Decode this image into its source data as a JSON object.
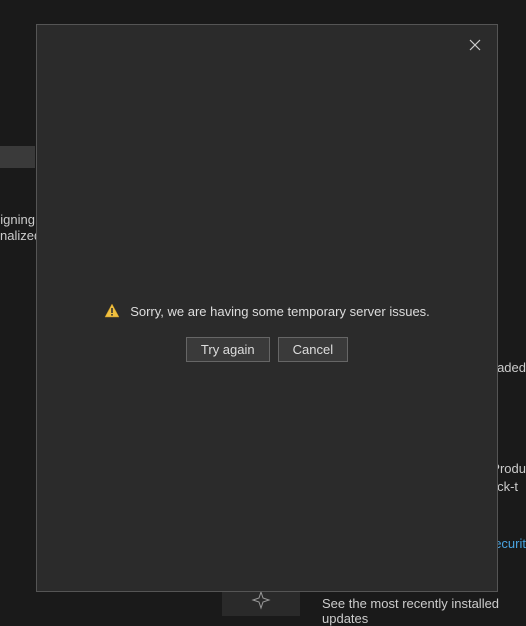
{
  "background": {
    "signing_text_line1": "igning",
    "signing_text_line2": "nalized",
    "loaded_text": "oaded",
    "product_line1": "Produ",
    "product_line2": "lick-t",
    "security_link": "ecurit",
    "updates_text": "See the most recently installed updates"
  },
  "modal": {
    "message": "Sorry, we are having some temporary server issues.",
    "try_again": "Try again",
    "cancel": "Cancel"
  }
}
